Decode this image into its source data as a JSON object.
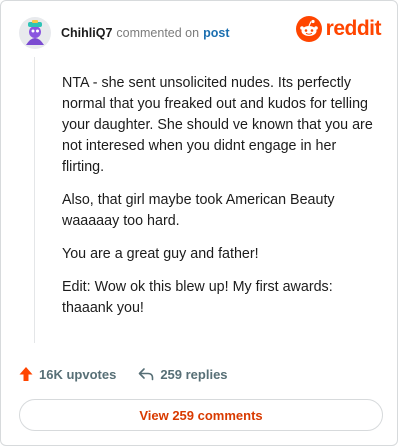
{
  "header": {
    "username": "ChihliQ7",
    "action_text": "commented on",
    "post_link": "post",
    "brand": "reddit"
  },
  "comment": {
    "paragraphs": [
      "NTA - she sent unsolicited nudes. Its perfectly normal that you freaked out and kudos for telling your daughter. She should ve known that you are not interesed when you didnt engage in her flirting.",
      "Also, that girl maybe took American Beauty waaaaay too hard.",
      "You are a great guy and father!",
      "Edit: Wow ok this blew up! My first awards: thaaank you!"
    ]
  },
  "actions": {
    "upvotes": "16K upvotes",
    "replies": "259 replies"
  },
  "footer": {
    "view_comments": "View 259 comments"
  },
  "colors": {
    "brand": "#ff4500",
    "link": "#1c6fb0",
    "muted": "#576f76"
  }
}
